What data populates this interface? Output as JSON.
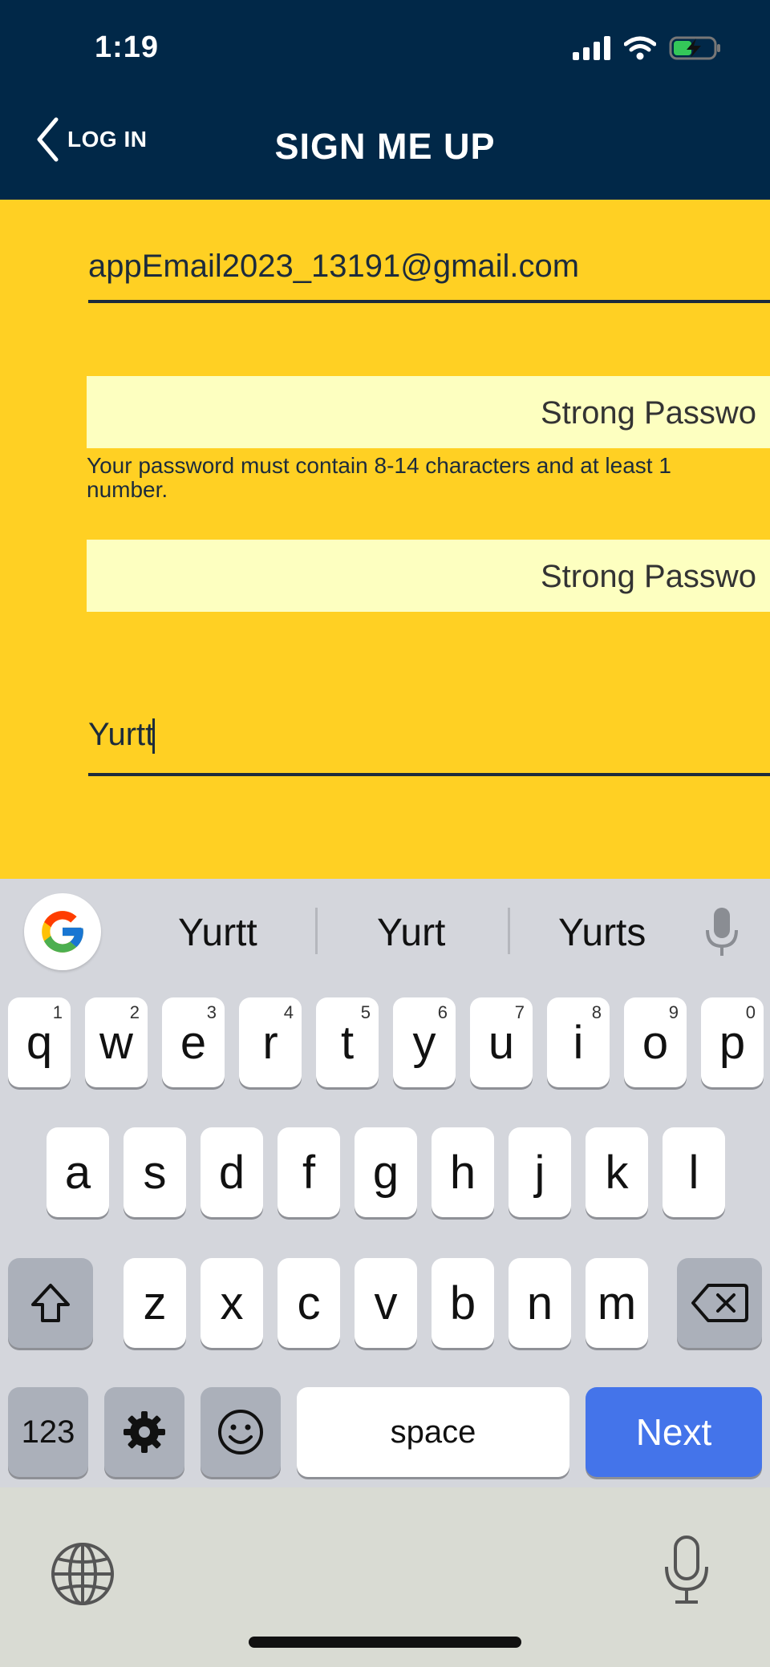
{
  "status": {
    "time": "1:19"
  },
  "header": {
    "back_label": "LOG IN",
    "title": "SIGN ME UP"
  },
  "form": {
    "email_value": "appEmail2023_13191@gmail.com",
    "password_label": "Strong Passwo",
    "password_hint": "Your password must contain 8-14 characters and at least 1 number.",
    "confirm_password_label": "Strong Passwo",
    "name_value": "Yurtt"
  },
  "keyboard": {
    "suggestions": [
      "Yurtt",
      "Yurt",
      "Yurts"
    ],
    "row1": [
      {
        "l": "q",
        "n": "1"
      },
      {
        "l": "w",
        "n": "2"
      },
      {
        "l": "e",
        "n": "3"
      },
      {
        "l": "r",
        "n": "4"
      },
      {
        "l": "t",
        "n": "5"
      },
      {
        "l": "y",
        "n": "6"
      },
      {
        "l": "u",
        "n": "7"
      },
      {
        "l": "i",
        "n": "8"
      },
      {
        "l": "o",
        "n": "9"
      },
      {
        "l": "p",
        "n": "0"
      }
    ],
    "row2": [
      "a",
      "s",
      "d",
      "f",
      "g",
      "h",
      "j",
      "k",
      "l"
    ],
    "row3": [
      "z",
      "x",
      "c",
      "v",
      "b",
      "n",
      "m"
    ],
    "numbers_label": "123",
    "space_label": "space",
    "next_label": "Next"
  },
  "colors": {
    "header_bg": "#012848",
    "page_bg": "#FFD023",
    "field_bg": "#FDFFC0",
    "next_key": "#4474EA"
  },
  "icons": [
    "cellular-signal-icon",
    "wifi-icon",
    "battery-charging-icon",
    "back-chevron-icon",
    "google-icon",
    "microphone-icon",
    "shift-icon",
    "backspace-icon",
    "gear-icon",
    "emoji-icon",
    "globe-icon"
  ]
}
